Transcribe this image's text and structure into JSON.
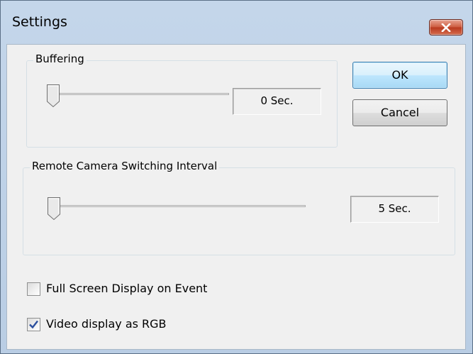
{
  "window": {
    "title": "Settings",
    "close_icon": "close-icon"
  },
  "buffering": {
    "label": "Buffering",
    "value_text": "0 Sec.",
    "slider_fraction": 0.0
  },
  "switching": {
    "label": "Remote Camera Switching Interval",
    "value_text": "5 Sec.",
    "slider_fraction": 0.0
  },
  "buttons": {
    "ok": "OK",
    "cancel": "Cancel"
  },
  "options": {
    "full_screen": {
      "label": "Full Screen Display on Event",
      "checked": false
    },
    "video_rgb": {
      "label": "Video display as RGB",
      "checked": true
    }
  },
  "colors": {
    "close_button": "#c9482f",
    "default_button_border": "#3c7fb1",
    "check_mark": "#2b4f9e"
  }
}
